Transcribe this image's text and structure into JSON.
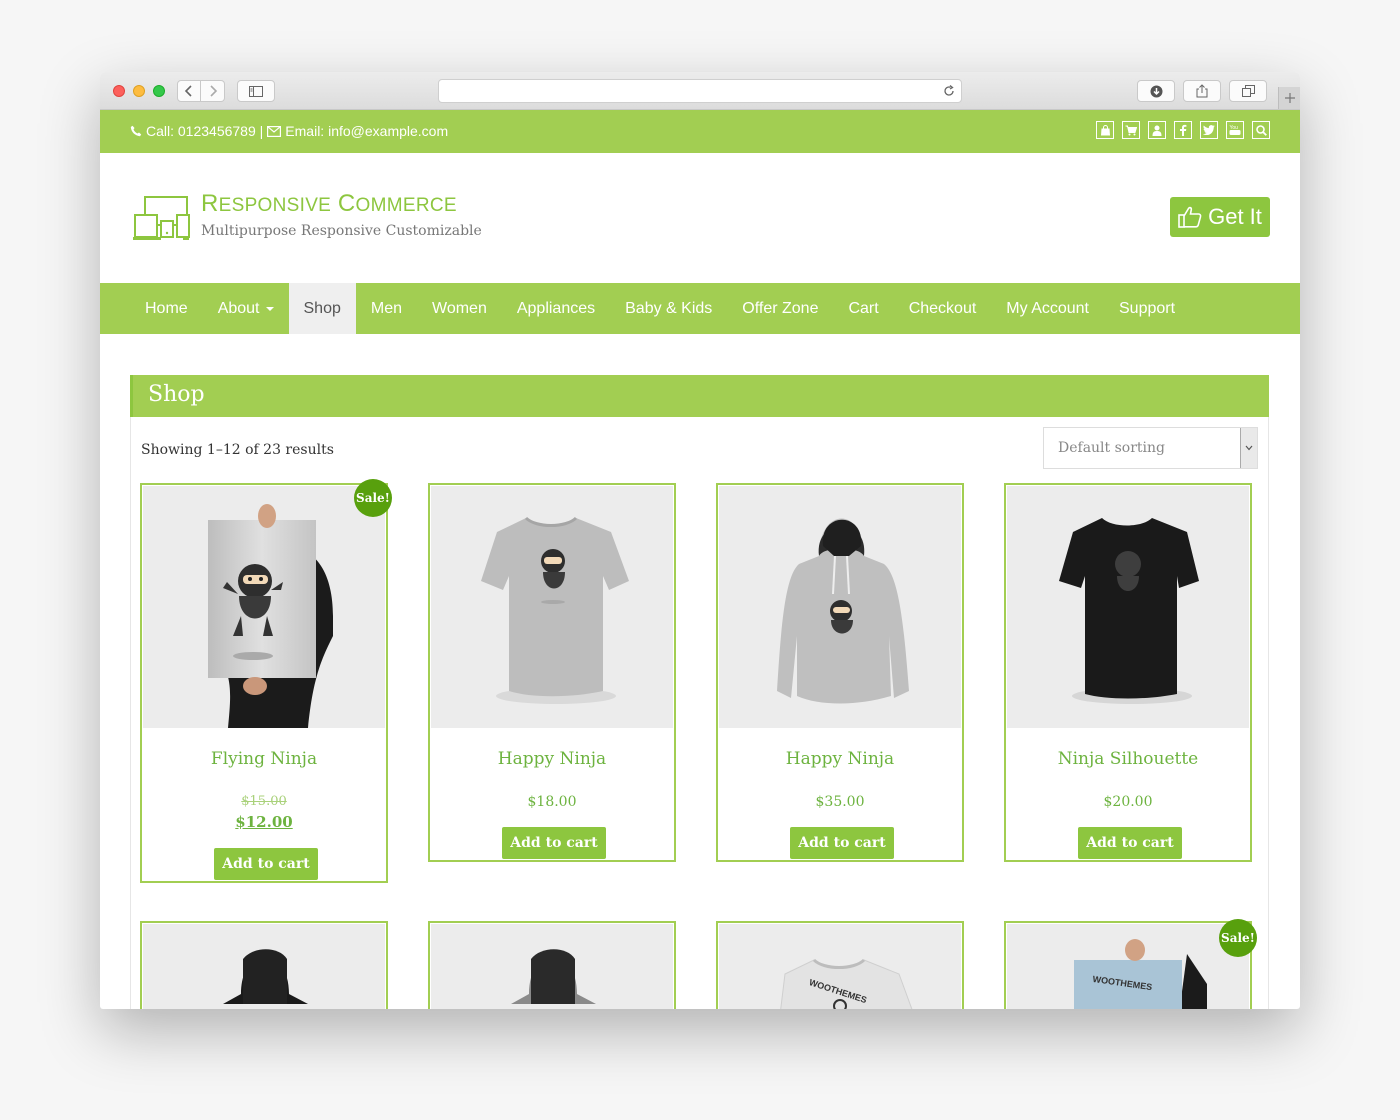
{
  "topbar": {
    "contact_text": "Call: 0123456789 | ",
    "email_text": "Email: info@example.com",
    "icons": [
      "shopping-bag-icon",
      "cart-icon",
      "user-icon",
      "facebook-icon",
      "twitter-icon",
      "youtube-icon",
      "search-icon"
    ]
  },
  "header": {
    "brand_first_r": "R",
    "brand_first_rest": "ESPONSIVE",
    "brand_second_c": "C",
    "brand_second_rest": "OMMERCE",
    "tagline": "Multipurpose Responsive Customizable",
    "cta_label": "Get It"
  },
  "nav": {
    "items": [
      "Home",
      "About",
      "Shop",
      "Men",
      "Women",
      "Appliances",
      "Baby & Kids",
      "Offer Zone",
      "Cart",
      "Checkout",
      "My Account",
      "Support"
    ],
    "active": "Shop"
  },
  "shop": {
    "title": "Shop",
    "result_count": "Showing 1–12 of 23 results",
    "sorting_value": "Default sorting"
  },
  "products": [
    {
      "title": "Flying Ninja",
      "old_price": "$15.00",
      "price": "$12.00",
      "sale": "Sale!",
      "button": "Add to cart"
    },
    {
      "title": "Happy Ninja",
      "price": "$18.00",
      "button": "Add to cart"
    },
    {
      "title": "Happy Ninja",
      "price": "$35.00",
      "button": "Add to cart"
    },
    {
      "title": "Ninja Silhouette",
      "price": "$20.00",
      "button": "Add to cart"
    },
    {
      "title": "",
      "price": "",
      "button": ""
    },
    {
      "title": "",
      "price": "",
      "button": ""
    },
    {
      "title": "",
      "price": "",
      "image_text": "WOOTHEMES",
      "button": ""
    },
    {
      "title": "",
      "price": "",
      "image_text": "WOOTHEMES",
      "sale": "Sale!",
      "button": ""
    }
  ],
  "colors": {
    "primary": "#a2ce52",
    "primary_dark": "#8dc63f",
    "text_green": "#6db33f",
    "sale_badge": "#58a00d"
  }
}
